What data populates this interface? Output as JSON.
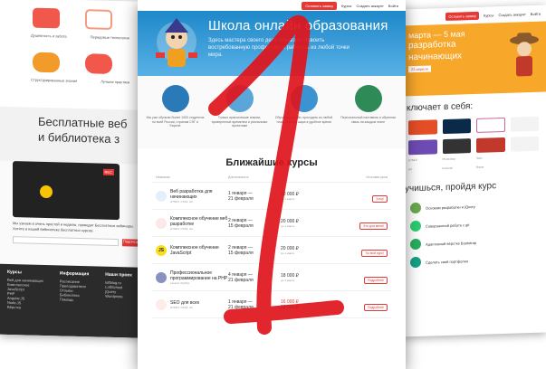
{
  "left_page": {
    "features": [
      "Душевность и забота",
      "Передовые технологии",
      "Структурированные знания",
      "Лучшие практики"
    ],
    "heading_lines": [
      "Бесплатные веб",
      "и библиотека з"
    ],
    "video_badge": "REC",
    "desc": "Мы узнаем в очень простой и неделю, проводит Бесплатные вебинары. Хотите в нашей библиотеке бесплатных курсов.",
    "subscribe_label": "Подписаться",
    "footer": {
      "cols": [
        {
          "title": "Курсы",
          "items": [
            "Веб для начинающих",
            "Комплексное",
            "JavaScript",
            "PHP",
            "Angular.JS",
            "Node.JS",
            "Вёрстка"
          ]
        },
        {
          "title": "Информация",
          "items": [
            "Расписание",
            "Преподаватели",
            "Отзывы",
            "Библиотека",
            "Помощь"
          ]
        },
        {
          "title": "Наши проек",
          "items": [
            "loftblog.ru",
            "LoftSchool",
            "jQuery",
            "Wordpress"
          ]
        }
      ]
    }
  },
  "right_page": {
    "header": {
      "signup": "Оставить заявку",
      "courses": "Курсы",
      "create": "Создать аккаунт",
      "login": "Войти"
    },
    "hero_date": "марта — 5 мая",
    "hero_title_lines": [
      "разработка",
      "начинающих"
    ],
    "hero_tag": "23 апреля",
    "includes_title": "ключает в себя:",
    "tech": [
      "HTML5",
      "Photoshop",
      "Sass",
      "",
      "Git",
      "Консоль",
      "Bower",
      ""
    ],
    "learn_title": "учишься, пройдя курс",
    "learn_items": [
      "Основам разработки и jQuery",
      "Совершенной работе с git",
      "Адаптивной вёрстке Bootstrap",
      "Сделать свой портфолио"
    ]
  },
  "center_page": {
    "header": {
      "signup": "Оставить заявку",
      "courses": "Курсы",
      "create": "Создать аккаунт",
      "login": "Войти"
    },
    "hero_title": "Школа онлайн образования",
    "hero_text": "Здесь мастера своего дела помогают освоить востребованную профессию и работать из любой точки мира.",
    "features": [
      "Мы уже обучили более 1000 студентов по всей России, странам СНГ и Европе",
      "Только практические знания, проверенные временем и реальными проектами",
      "Обучение онлайн, проходить из любой точки земного шара в удобное время",
      "Персональный наставник и обратная связь на каждом этапе"
    ],
    "courses_title": "Ближайшие курсы",
    "columns": [
      "Название",
      "Длительность",
      "",
      "Итоговая цена"
    ],
    "rows": [
      {
        "title": "Веб разработка для начинающих",
        "stack": "HTML5, CSS3, Git",
        "logo": "",
        "dur": "1 января —",
        "dur2": "21 февраля",
        "price": "20 000 ₽",
        "price_note": "до 1 марта",
        "old": "",
        "btn": "Хочу!"
      },
      {
        "title": "Комплексное обучение веб разработке",
        "stack": "HTML5, CSS3, Git",
        "logo": "",
        "dur": "2 января —",
        "dur2": "15 февраля",
        "price": "20 000 ₽",
        "price_note": "до 1 марта",
        "old": "",
        "btn": "Это для меня!"
      },
      {
        "title": "Комплексное обучение JavaScript",
        "stack": "",
        "logo": "JS",
        "dur": "2 января —",
        "dur2": "15 февраля",
        "price": "20 000 ₽",
        "price_note": "до 1 марта",
        "old": "",
        "btn": "Ты мой курс!"
      },
      {
        "title": "Профессиональное программирование на PHP",
        "stack": "Laravel, MySQL",
        "logo": "",
        "dur": "4 января —",
        "dur2": "21 февраля",
        "price": "18 000 ₽",
        "price_note": "до 1 марта",
        "old": "",
        "btn": "Подробнее"
      },
      {
        "title": "SEO для всех",
        "stack": "HTML5, CSS3, Git",
        "logo": "",
        "dur": "1 января —",
        "dur2": "21 февраля",
        "price": "18 000 ₽",
        "price_note": "до 1 марта",
        "old": "16 000 ₽",
        "btn": "Подробнее"
      }
    ]
  },
  "overlay_digit": "1",
  "colors": {
    "accent": "#e53935",
    "hero_blue": "#1e88c9",
    "orange": "#f7a72a",
    "digit": "#e0141b"
  }
}
